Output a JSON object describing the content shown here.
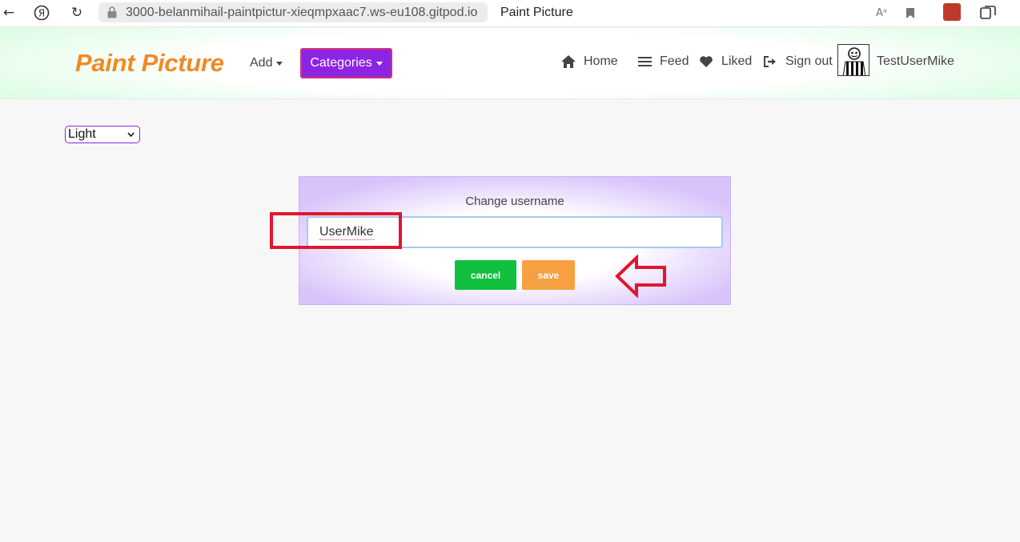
{
  "browser": {
    "url": "3000-belanmihail-paintpictur-xieqmpxaac7.ws-eu108.gitpod.io",
    "tab_title": "Paint Picture",
    "icons": [
      "back-icon",
      "yandex-icon",
      "reload-icon",
      "lock-icon",
      "translate-icon",
      "bookmark-icon",
      "extension-icon",
      "collections-icon"
    ]
  },
  "header": {
    "brand": "Paint Picture",
    "add_label": "Add",
    "categories_label": "Categories",
    "links": [
      {
        "label": "Home",
        "icon": "home-icon"
      },
      {
        "label": "Feed",
        "icon": "feed-icon"
      },
      {
        "label": "Liked",
        "icon": "heart-icon"
      },
      {
        "label": "Sign out",
        "icon": "sign-out-icon"
      }
    ],
    "username": "TestUserMike"
  },
  "theme": {
    "selected": "Light"
  },
  "form": {
    "title": "Change username",
    "input_value": "UserMike",
    "cancel_label": "cancel",
    "save_label": "save"
  },
  "colors": {
    "brand": "#ee8b26",
    "categories": "#8d24e4",
    "cancel": "#10c03e",
    "save": "#f6a042",
    "annotation": "#e0162e"
  }
}
